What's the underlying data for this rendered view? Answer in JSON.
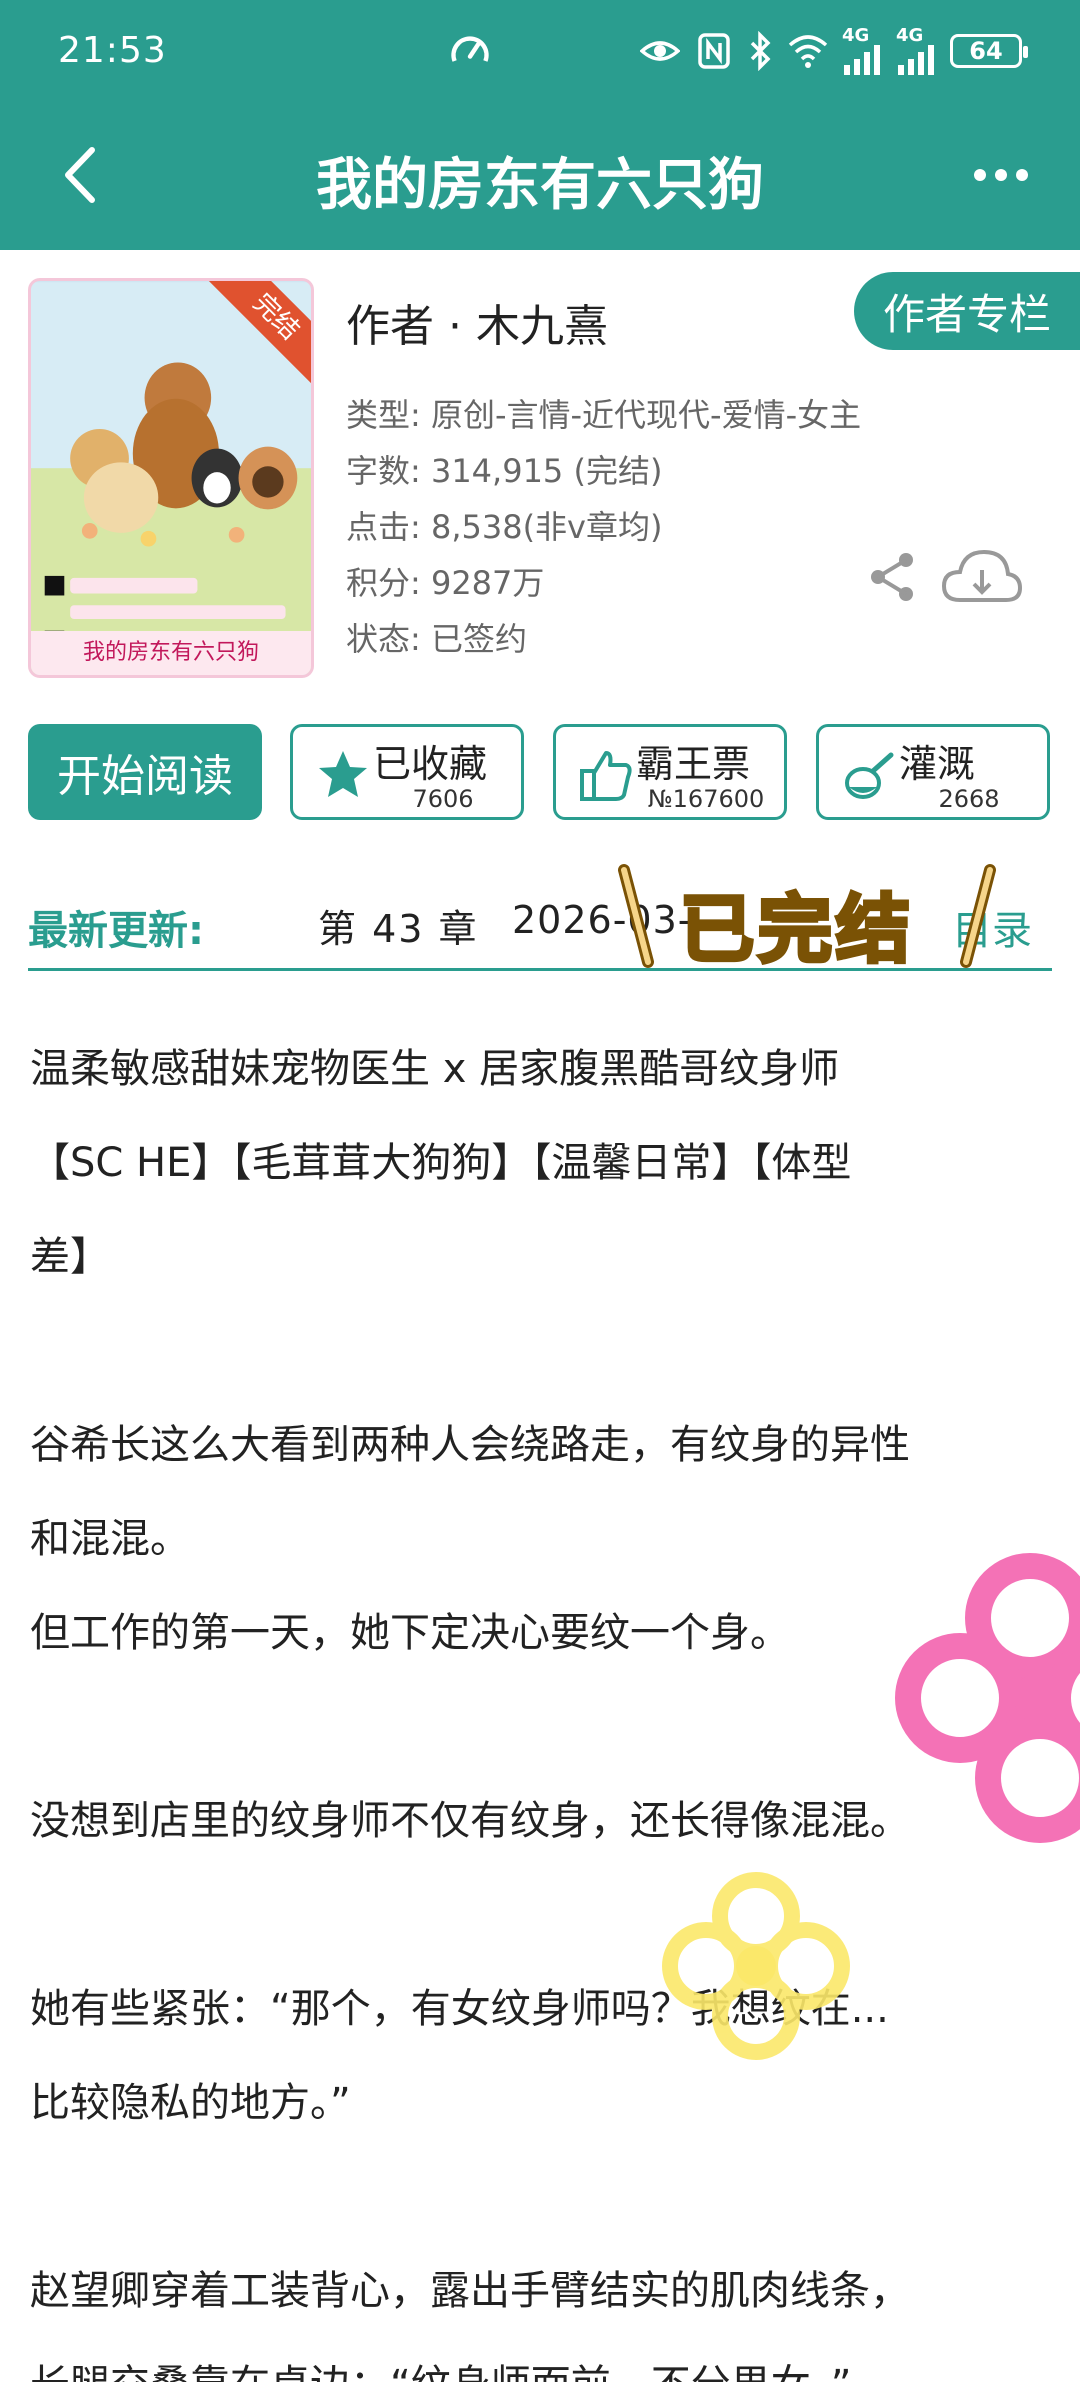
{
  "status": {
    "time": "21:53",
    "network1": "4G",
    "network2": "4G",
    "battery": "64"
  },
  "header": {
    "title": "我的房东有六只狗",
    "back_icon": "chevron-left-icon",
    "more_icon": "more-dots-icon"
  },
  "book": {
    "cover_badge": "完结",
    "cover_title": "我的房东有六只狗",
    "author": "作者 · 木九熹",
    "author_column": "作者专栏",
    "genre": "类型: 原创-言情-近代现代-爱情-女主",
    "words": "字数: 314,915 (完结)",
    "clicks": "点击: 8,538(非v章均)",
    "score": "积分: 9287万",
    "status": "状态: 已签约"
  },
  "actions": {
    "start_read": "开始阅读",
    "favorite_label": "已收藏",
    "favorite_count": "7606",
    "vote_label": "霸王票",
    "vote_count": "№167600",
    "water_label": "灌溉",
    "water_count": "2668"
  },
  "update": {
    "label": "最新更新:",
    "chapter": "第 43 章",
    "date": "2026-03-",
    "toc": "目录",
    "sticker": "已完结"
  },
  "description": [
    "温柔敏感甜妹宠物医生 x 居家腹黑酷哥纹身师",
    "【SC HE】【毛茸茸大狗狗】【温馨日常】【体型",
    "差】",
    "",
    "谷希长这么大看到两种人会绕路走，有纹身的异性",
    "和混混。",
    "但工作的第一天，她下定决心要纹一个身。",
    "",
    "没想到店里的纹身师不仅有纹身，还长得像混混。",
    "",
    "她有些紧张：“那个，有女纹身师吗？我想纹在...",
    "比较隐私的地方。”",
    "",
    "赵望卿穿着工装背心，露出手臂结实的肌肉线条，",
    "长腿交叠靠在桌边：“纹身师面前，不分男女。”"
  ],
  "colors": {
    "brand": "#2a9d8f",
    "ribbon": "#e0522f",
    "sticker_fill": "#f6d58a",
    "sticker_stroke": "#7a5205"
  }
}
